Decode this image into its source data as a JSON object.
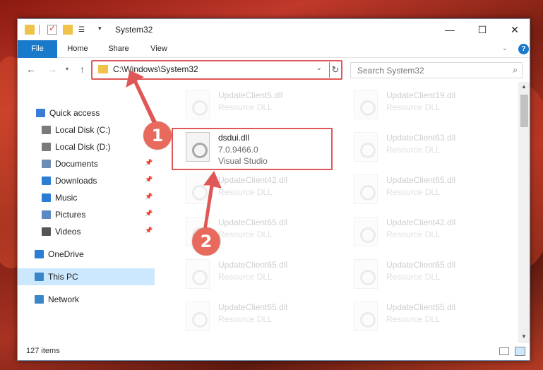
{
  "window": {
    "title": "System32",
    "controls": {
      "minimize": "—",
      "maximize": "☐",
      "close": "✕"
    }
  },
  "ribbon": {
    "file": "File",
    "home": "Home",
    "share": "Share",
    "view": "View",
    "help": "?"
  },
  "nav": {
    "address": "C:\\Windows\\System32",
    "search_placeholder": "Search System32"
  },
  "sidebar": {
    "items": [
      {
        "label": "Quick access",
        "icon": "star-icon",
        "color": "#3a7bd5",
        "pinned": false
      },
      {
        "label": "Local Disk (C:)",
        "icon": "drive-icon",
        "color": "#7a7a7a",
        "pinned": false
      },
      {
        "label": "Local Disk (D:)",
        "icon": "drive-icon",
        "color": "#7a7a7a",
        "pinned": false
      },
      {
        "label": "Documents",
        "icon": "documents-icon",
        "color": "#6d8cb5",
        "pinned": true
      },
      {
        "label": "Downloads",
        "icon": "downloads-icon",
        "color": "#2b7cd3",
        "pinned": true
      },
      {
        "label": "Music",
        "icon": "music-icon",
        "color": "#2b7cd3",
        "pinned": true
      },
      {
        "label": "Pictures",
        "icon": "pictures-icon",
        "color": "#5a8ac6",
        "pinned": true
      },
      {
        "label": "Videos",
        "icon": "videos-icon",
        "color": "#555555",
        "pinned": true
      },
      {
        "label": "OneDrive",
        "icon": "onedrive-icon",
        "color": "#2b7cd3",
        "pinned": false
      },
      {
        "label": "This PC",
        "icon": "computer-icon",
        "color": "#3a87c8",
        "pinned": false,
        "selected": true
      },
      {
        "label": "Network",
        "icon": "network-icon",
        "color": "#3a87c8",
        "pinned": false
      }
    ]
  },
  "files": {
    "left": [
      {
        "name": "UpdateClient5.dll",
        "desc": "Resource DLL",
        "faded": true
      },
      {
        "name": "dsdui.dll",
        "desc": "7.0.9466.0",
        "type": "Visual Studio",
        "faded": false,
        "highlighted": true
      },
      {
        "name": "UpdateClient42.dll",
        "desc": "Resource DLL",
        "faded": true
      },
      {
        "name": "UpdateClient65.dll",
        "desc": "Resource DLL",
        "faded": true
      },
      {
        "name": "UpdateClient65.dll",
        "desc": "Resource DLL",
        "faded": true
      },
      {
        "name": "UpdateClient65.dll",
        "desc": "Resource DLL",
        "faded": true
      }
    ],
    "right": [
      {
        "name": "UpdateClient19.dll",
        "desc": "Resource DLL",
        "faded": true
      },
      {
        "name": "UpdateClient63.dll",
        "desc": "Resource DLL",
        "faded": true
      },
      {
        "name": "UpdateClient65.dll",
        "desc": "Resource DLL",
        "faded": true
      },
      {
        "name": "UpdateClient42.dll",
        "desc": "Resource DLL",
        "faded": true
      },
      {
        "name": "UpdateClient65.dll",
        "desc": "Resource DLL",
        "faded": true
      },
      {
        "name": "UpdateClient65.dll",
        "desc": "Resource DLL",
        "faded": true
      }
    ]
  },
  "status": {
    "item_count": "127 items"
  },
  "annotations": {
    "callout1": "1",
    "callout2": "2",
    "accent": "#e05757"
  }
}
